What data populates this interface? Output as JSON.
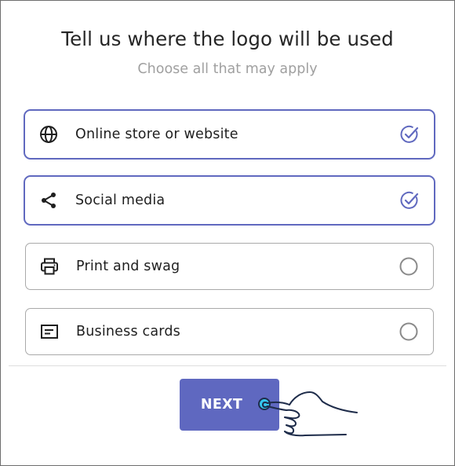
{
  "header": {
    "title": "Tell us where the logo will be used",
    "subtitle": "Choose all that may apply"
  },
  "options": [
    {
      "label": "Online store or website",
      "icon": "globe-icon",
      "selected": true
    },
    {
      "label": "Social media",
      "icon": "share-icon",
      "selected": true
    },
    {
      "label": "Print and swag",
      "icon": "printer-icon",
      "selected": false
    },
    {
      "label": "Business cards",
      "icon": "card-icon",
      "selected": false
    }
  ],
  "footer": {
    "next_label": "NEXT"
  },
  "colors": {
    "accent": "#5f68c0",
    "cursor": "#35c7ee",
    "border": "#a9a9a9"
  }
}
